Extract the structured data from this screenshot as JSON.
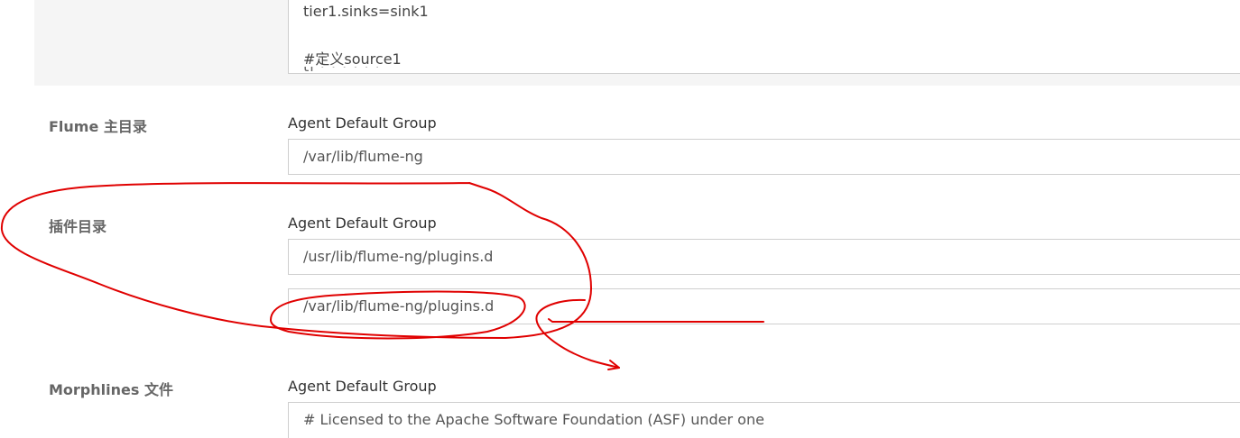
{
  "config_editor": {
    "line1": "tier1.sinks=sink1",
    "line2": "#定义source1",
    "line3_partial": "ti                                    ·   ·   ·   ·   ·          ·"
  },
  "rows": [
    {
      "label": "Flume 主目录",
      "group": "Agent Default Group",
      "values": [
        "/var/lib/flume-ng"
      ]
    },
    {
      "label": "插件目录",
      "group": "Agent Default Group",
      "values": [
        "/usr/lib/flume-ng/plugins.d",
        "/var/lib/flume-ng/plugins.d"
      ]
    },
    {
      "label": "Morphlines 文件",
      "group": "Agent Default Group",
      "values": [
        "# Licensed to the Apache Software Foundation (ASF) under one"
      ]
    }
  ],
  "annotation": {
    "color": "#e00000"
  }
}
